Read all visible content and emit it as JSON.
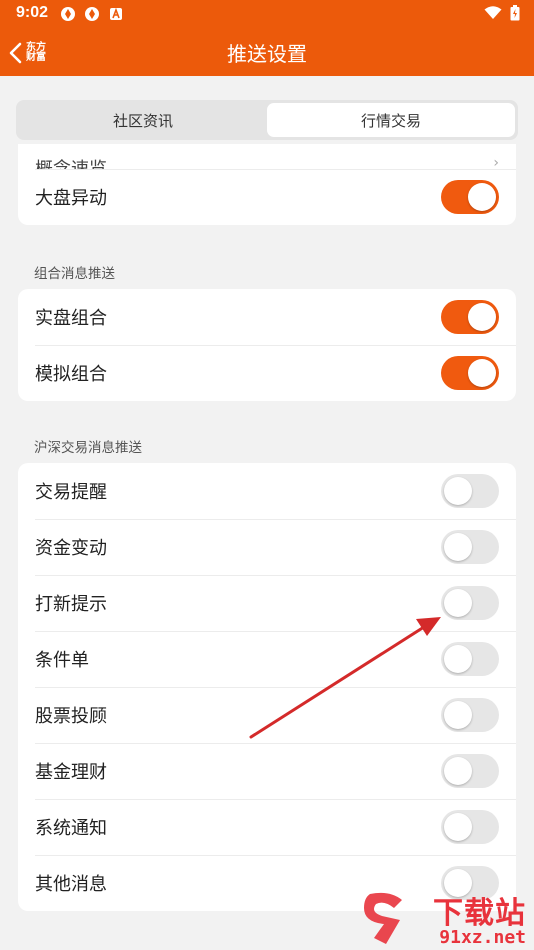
{
  "status_bar": {
    "time": "9:02"
  },
  "header": {
    "title": "推送设置",
    "back_logo_line1": "东方",
    "back_logo_line2": "财富"
  },
  "tabs": [
    {
      "label": "社区资讯",
      "active": false
    },
    {
      "label": "行情交易",
      "active": true
    }
  ],
  "card_market": {
    "rows": [
      {
        "label": "概念速览"
      },
      {
        "label": "大盘异动",
        "enabled": true
      }
    ]
  },
  "section_portfolio": {
    "label": "组合消息推送",
    "rows": [
      {
        "label": "实盘组合",
        "enabled": true
      },
      {
        "label": "模拟组合",
        "enabled": true
      }
    ]
  },
  "section_trade": {
    "label": "沪深交易消息推送",
    "rows": [
      {
        "label": "交易提醒",
        "enabled": false
      },
      {
        "label": "资金变动",
        "enabled": false
      },
      {
        "label": "打新提示",
        "enabled": false
      },
      {
        "label": "条件单",
        "enabled": false
      },
      {
        "label": "股票投顾",
        "enabled": false
      },
      {
        "label": "基金理财",
        "enabled": false
      },
      {
        "label": "系统通知",
        "enabled": false
      },
      {
        "label": "其他消息",
        "enabled": false
      }
    ]
  },
  "watermark": {
    "top_text": "下载站",
    "bottom_text": "91xz.net"
  },
  "colors": {
    "accent": "#ec5a0b",
    "toggle_on": "#f05a0f",
    "toggle_off": "#e6e6e6",
    "annotation_arrow": "#d42a2a"
  }
}
